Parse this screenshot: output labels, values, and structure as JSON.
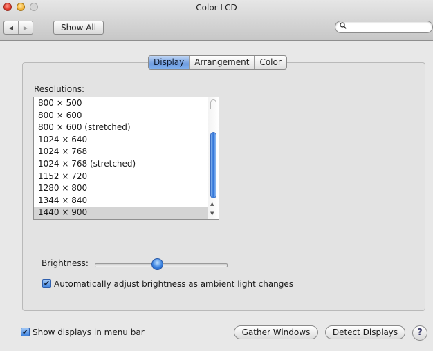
{
  "window": {
    "title": "Color LCD"
  },
  "toolbar": {
    "back_icon": "◀",
    "forward_icon": "▶",
    "show_all_label": "Show All",
    "search_icon": "⚲",
    "search_value": "",
    "search_placeholder": ""
  },
  "tabs": [
    {
      "label": "Display",
      "active": true
    },
    {
      "label": "Arrangement",
      "active": false
    },
    {
      "label": "Color",
      "active": false
    }
  ],
  "resolutions": {
    "label": "Resolutions:",
    "items": [
      "800 × 500",
      "800 × 600",
      "800 × 600 (stretched)",
      "1024 × 640",
      "1024 × 768",
      "1024 × 768 (stretched)",
      "1152 × 720",
      "1280 × 800",
      "1344 × 840",
      "1440 × 900"
    ],
    "selected": "1440 × 900"
  },
  "brightness": {
    "label": "Brightness:",
    "level": 0.47
  },
  "auto_brightness": {
    "label": "Automatically adjust brightness as ambient light changes",
    "checked": true,
    "check_glyph": "✔"
  },
  "footer": {
    "show_in_menu_label": "Show displays in menu bar",
    "show_in_menu_checked": true,
    "check_glyph": "✔",
    "gather_label": "Gather Windows",
    "detect_label": "Detect Displays",
    "help_label": "?"
  },
  "colors": {
    "accent": "#3a82e0",
    "selected_row": "#d4d4d4"
  }
}
